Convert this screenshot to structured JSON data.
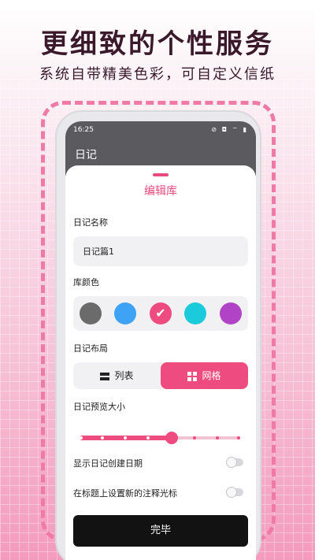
{
  "headline": "更细致的个性服务",
  "subline": "系统自带精美色彩，可自定义信纸",
  "status_bar": {
    "time": "16:25",
    "icons": "⊘ ◘ ⌔ ▮"
  },
  "app_bar": {
    "title": "日记"
  },
  "sheet": {
    "title": "编辑库",
    "name_label": "日记名称",
    "name_value": "日记篇1",
    "color_label": "库颜色",
    "colors": [
      {
        "hex": "#6b6b6b",
        "selected": false
      },
      {
        "hex": "#3fa3f5",
        "selected": false
      },
      {
        "hex": "#ee4b80",
        "selected": true
      },
      {
        "hex": "#1bcbdc",
        "selected": false
      },
      {
        "hex": "#b043c6",
        "selected": false
      }
    ],
    "layout_label": "日记布局",
    "layout_options": {
      "list": "列表",
      "grid": "网格",
      "selected": "grid"
    },
    "preview_size_label": "日记预览大小",
    "preview_size": {
      "steps": 8,
      "value_index": 4
    },
    "toggle_show_date": {
      "label": "显示日记创建日期",
      "on": false
    },
    "toggle_title_cursor": {
      "label": "在标题上设置新的注释光标",
      "on": false
    },
    "done_label": "完毕"
  },
  "colors": {
    "accent": "#ee4b80",
    "appbar": "#5b5b5f"
  }
}
